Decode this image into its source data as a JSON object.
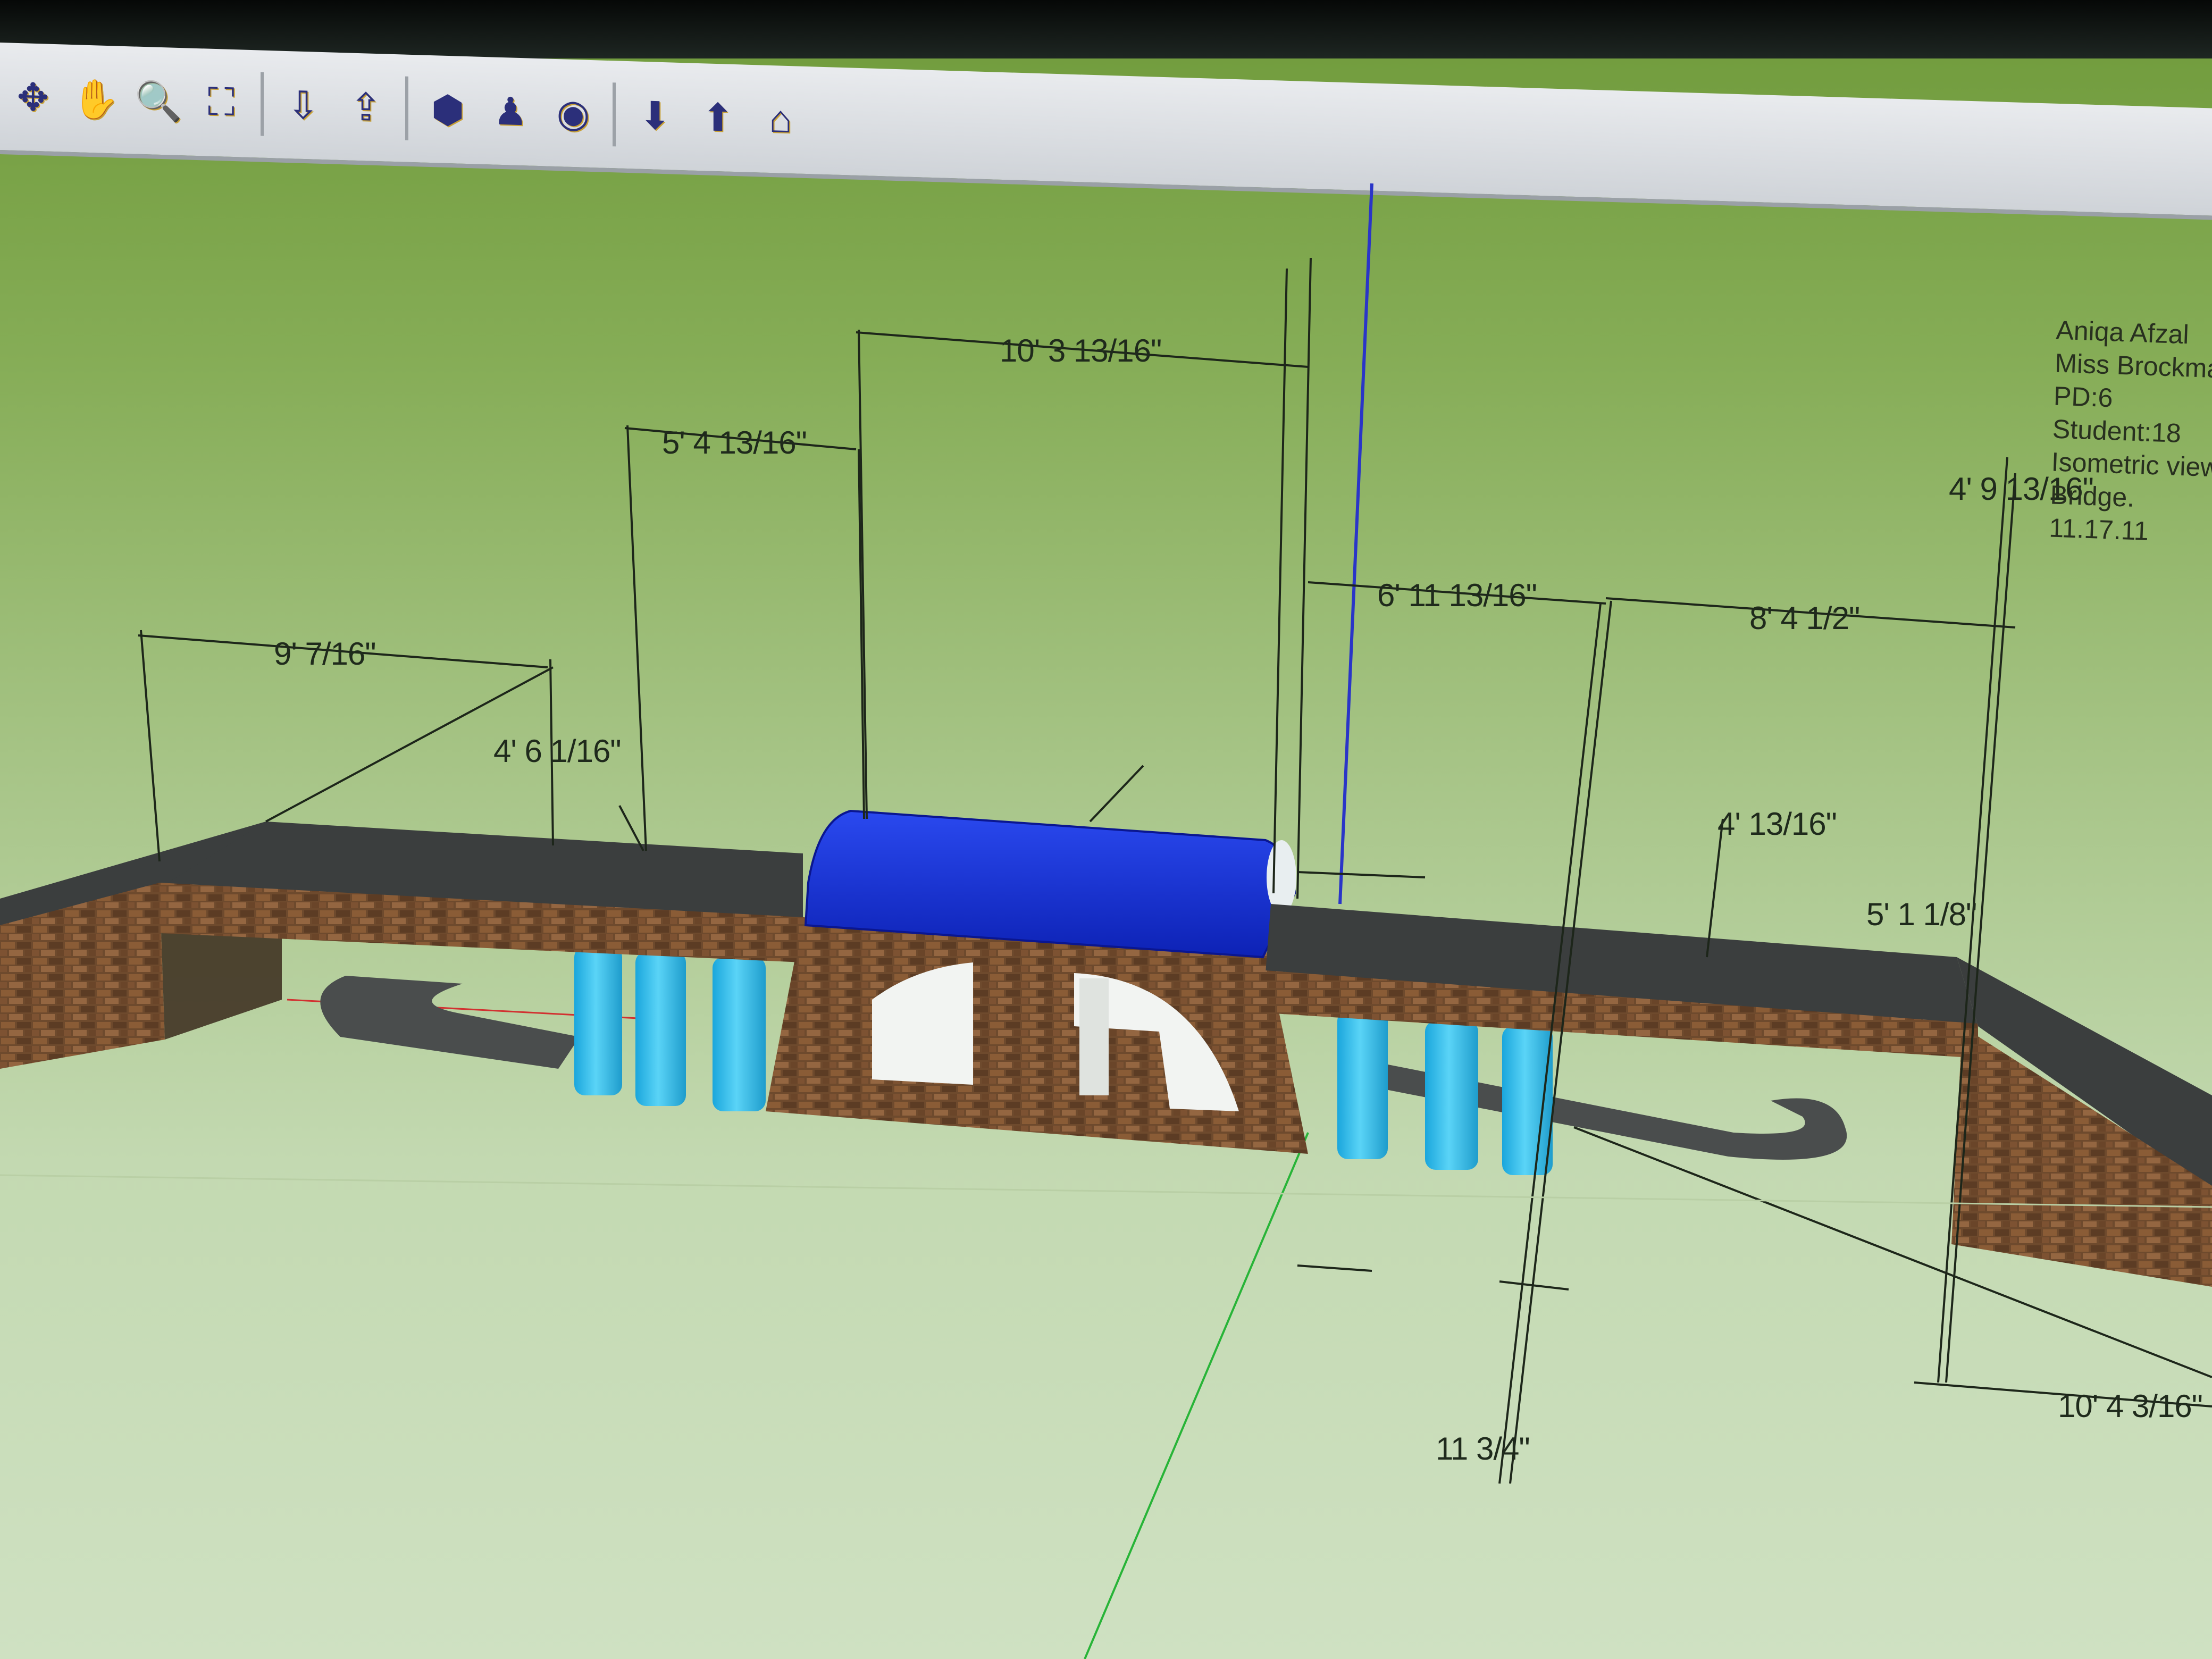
{
  "toolbar": {
    "tools": [
      {
        "name": "orbit-tool",
        "glyph": "✥"
      },
      {
        "name": "pan-tool",
        "glyph": "✋"
      },
      {
        "name": "zoom-tool",
        "glyph": "🔍"
      },
      {
        "name": "zoom-extents-tool",
        "glyph": "⛶"
      },
      {
        "name": "get-models-tool",
        "glyph": "⇩"
      },
      {
        "name": "share-model-tool",
        "glyph": "⇪"
      },
      {
        "name": "walk-tool",
        "glyph": "⬢"
      },
      {
        "name": "position-camera-tool",
        "glyph": "♟"
      },
      {
        "name": "look-around-tool",
        "glyph": "◉"
      },
      {
        "name": "get-component-tool",
        "glyph": "⬇"
      },
      {
        "name": "share-component-tool",
        "glyph": "⬆"
      },
      {
        "name": "section-tool",
        "glyph": "⌂"
      }
    ]
  },
  "dimensions": {
    "d1": "9' 7/16\"",
    "d2": "4' 6 1/16\"",
    "d3": "5' 4 13/16\"",
    "d4": "10' 3 13/16\"",
    "d5": "6' 11 13/16\"",
    "d6": "8' 4 1/2\"",
    "d7": "4' 9 13/16\"",
    "d8": "4' 13/16\"",
    "d9": "5' 1 1/8\"",
    "d10": "10' 4 3/16\"",
    "d11": "11 3/4\""
  },
  "note": {
    "name": "Aniqa Afzal",
    "teacher": "Miss Brockma",
    "period": "PD:6",
    "student": "Student:18",
    "view": "Isometric view",
    "subject": "Bridge.",
    "date": "11.17.11"
  },
  "colors": {
    "background": "#86ad57",
    "brick": "#6e4a2d",
    "deck": "#3b3e3e",
    "roof": "#1530d0",
    "pillar": "#38c2ee",
    "road": "#4a4d4d"
  }
}
